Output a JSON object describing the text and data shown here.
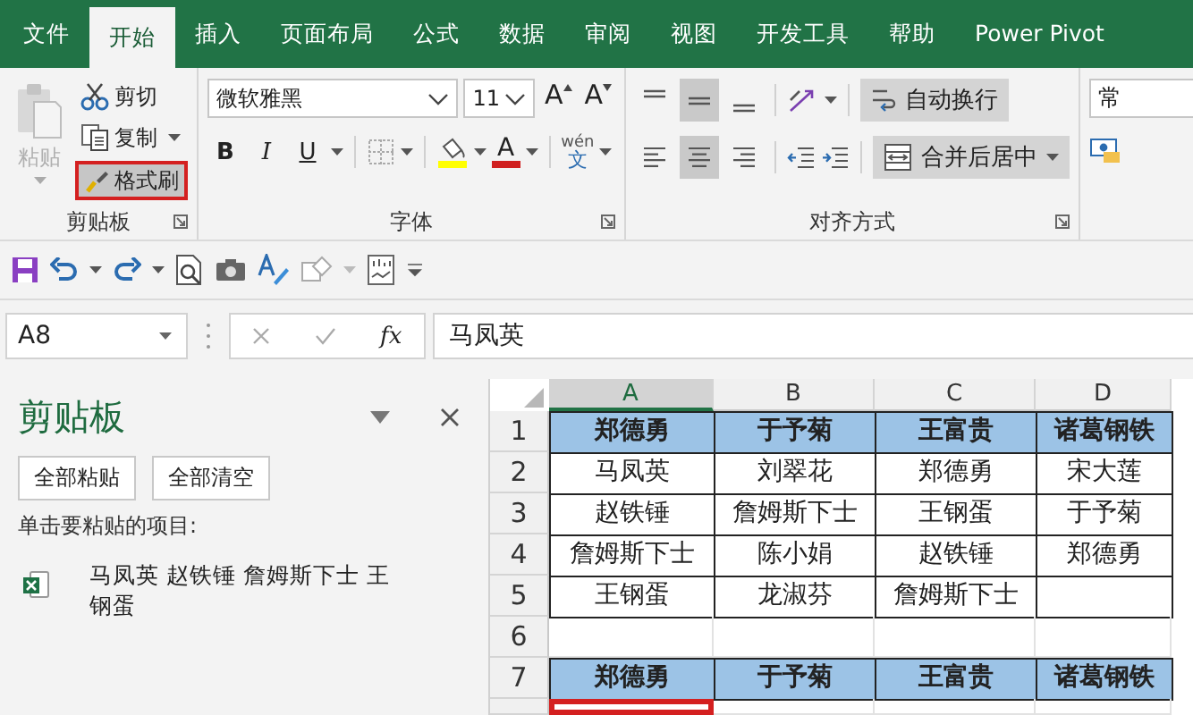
{
  "tabs": [
    {
      "label": "文件",
      "selected": false
    },
    {
      "label": "开始",
      "selected": true
    },
    {
      "label": "插入",
      "selected": false
    },
    {
      "label": "页面布局",
      "selected": false
    },
    {
      "label": "公式",
      "selected": false
    },
    {
      "label": "数据",
      "selected": false
    },
    {
      "label": "审阅",
      "selected": false
    },
    {
      "label": "视图",
      "selected": false
    },
    {
      "label": "开发工具",
      "selected": false
    },
    {
      "label": "帮助",
      "selected": false
    },
    {
      "label": "Power Pivot",
      "selected": false
    }
  ],
  "ribbon": {
    "clipboard": {
      "paste": {
        "label": "粘贴",
        "disabled": true
      },
      "cut": "剪切",
      "copy": "复制",
      "format_painter": {
        "label": "格式刷",
        "highlighted": true
      },
      "label": "剪贴板"
    },
    "font": {
      "font_name": "微软雅黑",
      "font_size": "11",
      "grow_font": "A",
      "shrink_font": "A",
      "bold": "B",
      "italic": "I",
      "underline": "U",
      "font_color": "A",
      "phonetic": {
        "ruby": "wén",
        "text": "文"
      },
      "label": "字体"
    },
    "alignment": {
      "vertical": [
        {
          "selected": false
        },
        {
          "selected": true
        },
        {
          "selected": false
        }
      ],
      "horizontal": [
        {
          "selected": false
        },
        {
          "selected": true
        },
        {
          "selected": false
        }
      ],
      "wrap_text": "自动换行",
      "merge": "合并后居中",
      "label": "对齐方式"
    },
    "number": {
      "format": "常"
    }
  },
  "formula_bar": {
    "name_box": "A8",
    "function_label": "fx",
    "value": "马凤英"
  },
  "clipboard_pane": {
    "title": "剪贴板",
    "buttons": [
      "全部粘贴",
      "全部清空"
    ],
    "hint": "单击要粘贴的项目:",
    "items": [
      {
        "text": "马凤英 赵铁锤 詹姆斯下士 王钢蛋"
      }
    ]
  },
  "sheet": {
    "columns": [
      {
        "label": "A",
        "selected": true
      },
      {
        "label": "B",
        "selected": false
      },
      {
        "label": "C",
        "selected": false
      },
      {
        "label": "D",
        "selected": false
      }
    ],
    "rows": [
      {
        "number": "1",
        "kind": "header",
        "cells": [
          {
            "text": "郑德勇",
            "selected": false
          },
          {
            "text": "于予菊",
            "selected": false
          },
          {
            "text": "王富贵",
            "selected": false
          },
          {
            "text": "诸葛钢铁",
            "selected": false
          }
        ]
      },
      {
        "number": "2",
        "kind": "data",
        "cells": [
          {
            "text": "马凤英",
            "selected": false
          },
          {
            "text": "刘翠花",
            "selected": false
          },
          {
            "text": "郑德勇",
            "selected": false
          },
          {
            "text": "宋大莲",
            "selected": false
          }
        ]
      },
      {
        "number": "3",
        "kind": "data",
        "cells": [
          {
            "text": "赵铁锤",
            "selected": false
          },
          {
            "text": "詹姆斯下士",
            "selected": false
          },
          {
            "text": "王钢蛋",
            "selected": false
          },
          {
            "text": "于予菊",
            "selected": false
          }
        ]
      },
      {
        "number": "4",
        "kind": "data",
        "cells": [
          {
            "text": "詹姆斯下士",
            "selected": false
          },
          {
            "text": "陈小娟",
            "selected": false
          },
          {
            "text": "赵铁锤",
            "selected": false
          },
          {
            "text": "郑德勇",
            "selected": false
          }
        ]
      },
      {
        "number": "5",
        "kind": "data",
        "cells": [
          {
            "text": "王钢蛋",
            "selected": false
          },
          {
            "text": "龙淑芬",
            "selected": false
          },
          {
            "text": "詹姆斯下士",
            "selected": false
          },
          {
            "selected": false
          }
        ]
      },
      {
        "number": "6",
        "kind": "blank",
        "cells": [
          {
            "selected": false
          },
          {
            "selected": false
          },
          {
            "selected": false
          },
          {
            "selected": false
          }
        ]
      },
      {
        "number": "7",
        "kind": "header",
        "cells": [
          {
            "text": "郑德勇",
            "selected": false
          },
          {
            "text": "于予菊",
            "selected": false
          },
          {
            "text": "王富贵",
            "selected": false
          },
          {
            "text": "诸葛钢铁",
            "selected": false
          }
        ]
      },
      {
        "kind": "blank",
        "cells": [
          {
            "selected": true
          },
          {
            "selected": false
          },
          {
            "selected": false
          },
          {
            "selected": false
          }
        ]
      }
    ]
  }
}
